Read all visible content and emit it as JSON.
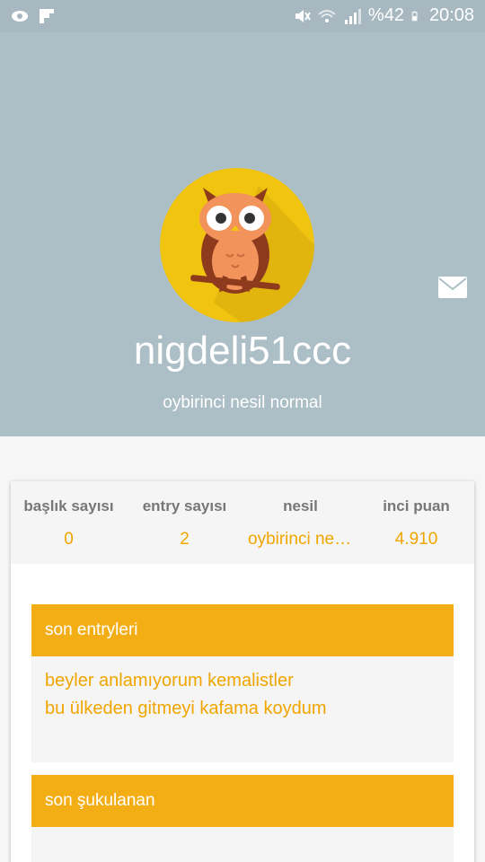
{
  "status_bar": {
    "battery": "%42",
    "time": "20:08"
  },
  "profile": {
    "username": "nigdeli51ccc",
    "title": "oybirinci nesil normal"
  },
  "stats": [
    {
      "label": "başlık sayısı",
      "value": "0"
    },
    {
      "label": "entry sayısı",
      "value": "2"
    },
    {
      "label": "nesil",
      "value": "oybirinci nesi..."
    },
    {
      "label": "inci puan",
      "value": "4.910"
    }
  ],
  "sections": {
    "recent_entries": {
      "title": "son entryleri",
      "items": [
        "beyler anlamıyorum kemalistler",
        "bu ülkeden gitmeyi kafama koydum"
      ]
    },
    "favorited": {
      "title": "son şukulanan"
    }
  }
}
